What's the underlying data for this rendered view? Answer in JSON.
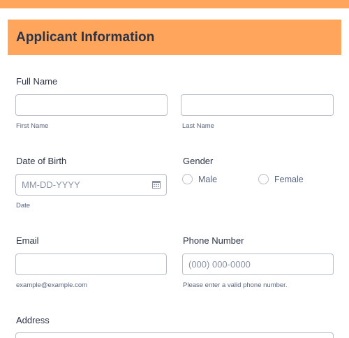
{
  "section": {
    "title": "Applicant Information"
  },
  "full_name": {
    "label": "Full Name",
    "first_sublabel": "First Name",
    "last_sublabel": "Last Name",
    "first_value": "",
    "last_value": ""
  },
  "dob": {
    "label": "Date of Birth",
    "placeholder": "MM-DD-YYYY",
    "sublabel": "Date",
    "icon": "calendar-icon"
  },
  "gender": {
    "label": "Gender",
    "options": [
      "Male",
      "Female"
    ]
  },
  "email": {
    "label": "Email",
    "value": "",
    "sublabel": "example@example.com"
  },
  "phone": {
    "label": "Phone Number",
    "placeholder": "(000) 000-0000",
    "sublabel": "Please enter a valid phone number."
  },
  "address": {
    "label": "Address",
    "value": ""
  },
  "colors": {
    "accent": "#ffa55c",
    "border": "#b8bdc9",
    "text": "#2c3345",
    "subtext": "#57647e"
  }
}
